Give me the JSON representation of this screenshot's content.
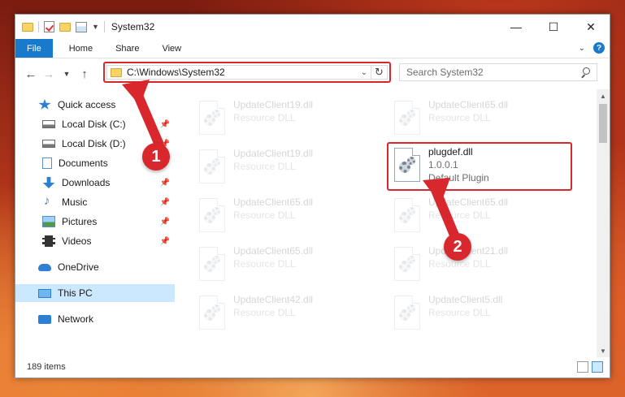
{
  "window": {
    "title": "System32",
    "controls": {
      "minimize": "—",
      "maximize": "☐",
      "close": "✕"
    }
  },
  "ribbon": {
    "tabs": [
      "File",
      "Home",
      "Share",
      "View"
    ],
    "expand_icon": "chevron-down-icon",
    "help_label": "?"
  },
  "nav": {
    "address": "C:\\Windows\\System32",
    "search_placeholder": "Search System32"
  },
  "sidebar": {
    "items": [
      {
        "label": "Quick access",
        "icon": "star-icon",
        "pinned": false
      },
      {
        "label": "Local Disk (C:)",
        "icon": "drive-icon",
        "pinned": true
      },
      {
        "label": "Local Disk (D:)",
        "icon": "drive-icon",
        "pinned": true
      },
      {
        "label": "Documents",
        "icon": "documents-icon",
        "pinned": true
      },
      {
        "label": "Downloads",
        "icon": "downloads-icon",
        "pinned": true
      },
      {
        "label": "Music",
        "icon": "music-icon",
        "pinned": true
      },
      {
        "label": "Pictures",
        "icon": "pictures-icon",
        "pinned": true
      },
      {
        "label": "Videos",
        "icon": "videos-icon",
        "pinned": true
      },
      {
        "label": "OneDrive",
        "icon": "onedrive-icon",
        "pinned": false
      },
      {
        "label": "This PC",
        "icon": "this-pc-icon",
        "pinned": false,
        "selected": true
      },
      {
        "label": "Network",
        "icon": "network-icon",
        "pinned": false
      }
    ]
  },
  "files": [
    {
      "name": "UpdateClient19.dll",
      "sub1": "Resource DLL",
      "sub2": ""
    },
    {
      "name": "UpdateClient65.dll",
      "sub1": "Resource DLL",
      "sub2": ""
    },
    {
      "name": "UpdateClient19.dll",
      "sub1": "Resource DLL",
      "sub2": ""
    },
    {
      "name": "plugdef.dll",
      "sub1": "1.0.0.1",
      "sub2": "Default Plugin"
    },
    {
      "name": "UpdateClient65.dll",
      "sub1": "Resource DLL",
      "sub2": ""
    },
    {
      "name": "UpdateClient65.dll",
      "sub1": "Resource DLL",
      "sub2": ""
    },
    {
      "name": "UpdateClient65.dll",
      "sub1": "Resource DLL",
      "sub2": ""
    },
    {
      "name": "UpdateClient21.dll",
      "sub1": "Resource DLL",
      "sub2": ""
    },
    {
      "name": "UpdateClient42.dll",
      "sub1": "Resource DLL",
      "sub2": ""
    },
    {
      "name": "UpdateClient5.dll",
      "sub1": "Resource DLL",
      "sub2": ""
    }
  ],
  "status": {
    "item_count": "189 items"
  },
  "callouts": [
    "1",
    "2"
  ],
  "colors": {
    "accent": "#1979ca",
    "highlight": "#d9272e",
    "selected": "#cce8ff"
  }
}
